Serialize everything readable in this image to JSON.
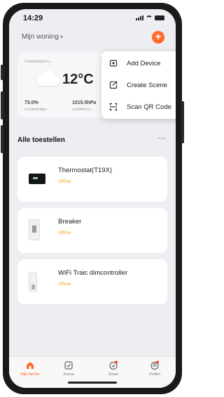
{
  "status_bar": {
    "time": "14:29"
  },
  "home": {
    "title": "Mijn woning"
  },
  "weather": {
    "label": "Comfortabel w...",
    "temperature": "12°C",
    "humidity_value": "73.0%",
    "humidity_label": "Luchtvochtigh...",
    "pressure_value": "1015.5hPa",
    "pressure_label": "Luchtdruk b..."
  },
  "menu": {
    "items": [
      {
        "label": "Add Device",
        "icon": "add-device-icon"
      },
      {
        "label": "Create Scene",
        "icon": "create-scene-icon"
      },
      {
        "label": "Scan QR Code",
        "icon": "scan-qr-icon"
      }
    ]
  },
  "devices_section": {
    "title": "Alle toestellen",
    "more": "···"
  },
  "devices": [
    {
      "name": "Thermostat(T19X)",
      "status": "Offline"
    },
    {
      "name": "Breaker",
      "status": "Offline"
    },
    {
      "name": "WiFi Traic dimcontroller",
      "status": "Offline"
    }
  ],
  "tabs": [
    {
      "label": "Mijn familie",
      "icon": "home-icon",
      "active": true
    },
    {
      "label": "Scene",
      "icon": "scene-icon",
      "active": false
    },
    {
      "label": "Smart",
      "icon": "smart-icon",
      "active": false
    },
    {
      "label": "Profiel",
      "icon": "profile-icon",
      "active": false
    }
  ],
  "colors": {
    "accent": "#ff6a2b",
    "offline": "#f5a623"
  }
}
